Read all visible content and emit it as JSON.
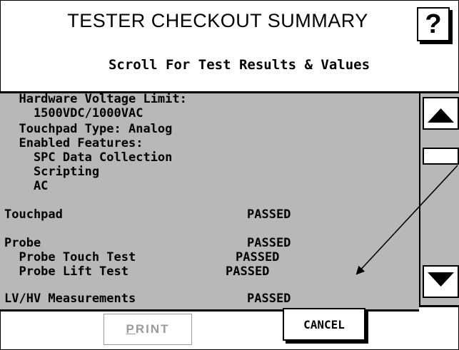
{
  "dialog": {
    "title": "TESTER CHECKOUT SUMMARY",
    "help_label": "?",
    "subtitle": "Scroll For Test Results & Values"
  },
  "results": {
    "lines": [
      "  Hardware Voltage Limit:",
      "    1500VDC/1000VAC",
      "  Touchpad Type: Analog",
      "  Enabled Features:",
      "    SPC Data Collection",
      "    Scripting",
      "    AC",
      "Touchpad",
      "Probe",
      "  Probe Touch Test",
      "  Probe Lift Test",
      "LV/HV Measurements"
    ],
    "statuses": {
      "touchpad": "PASSED",
      "probe": "PASSED",
      "probe_touch": "PASSED",
      "probe_lift": "PASSED",
      "lv_hv": "PASSED"
    }
  },
  "buttons": {
    "print_first": "P",
    "print_rest": "RINT",
    "cancel": "CANCEL"
  },
  "scrollbar": {
    "up_icon": "triangle-up",
    "down_icon": "triangle-down"
  },
  "colors": {
    "list_background": "#b8b8b8",
    "disabled_text": "#9a9a9a"
  }
}
